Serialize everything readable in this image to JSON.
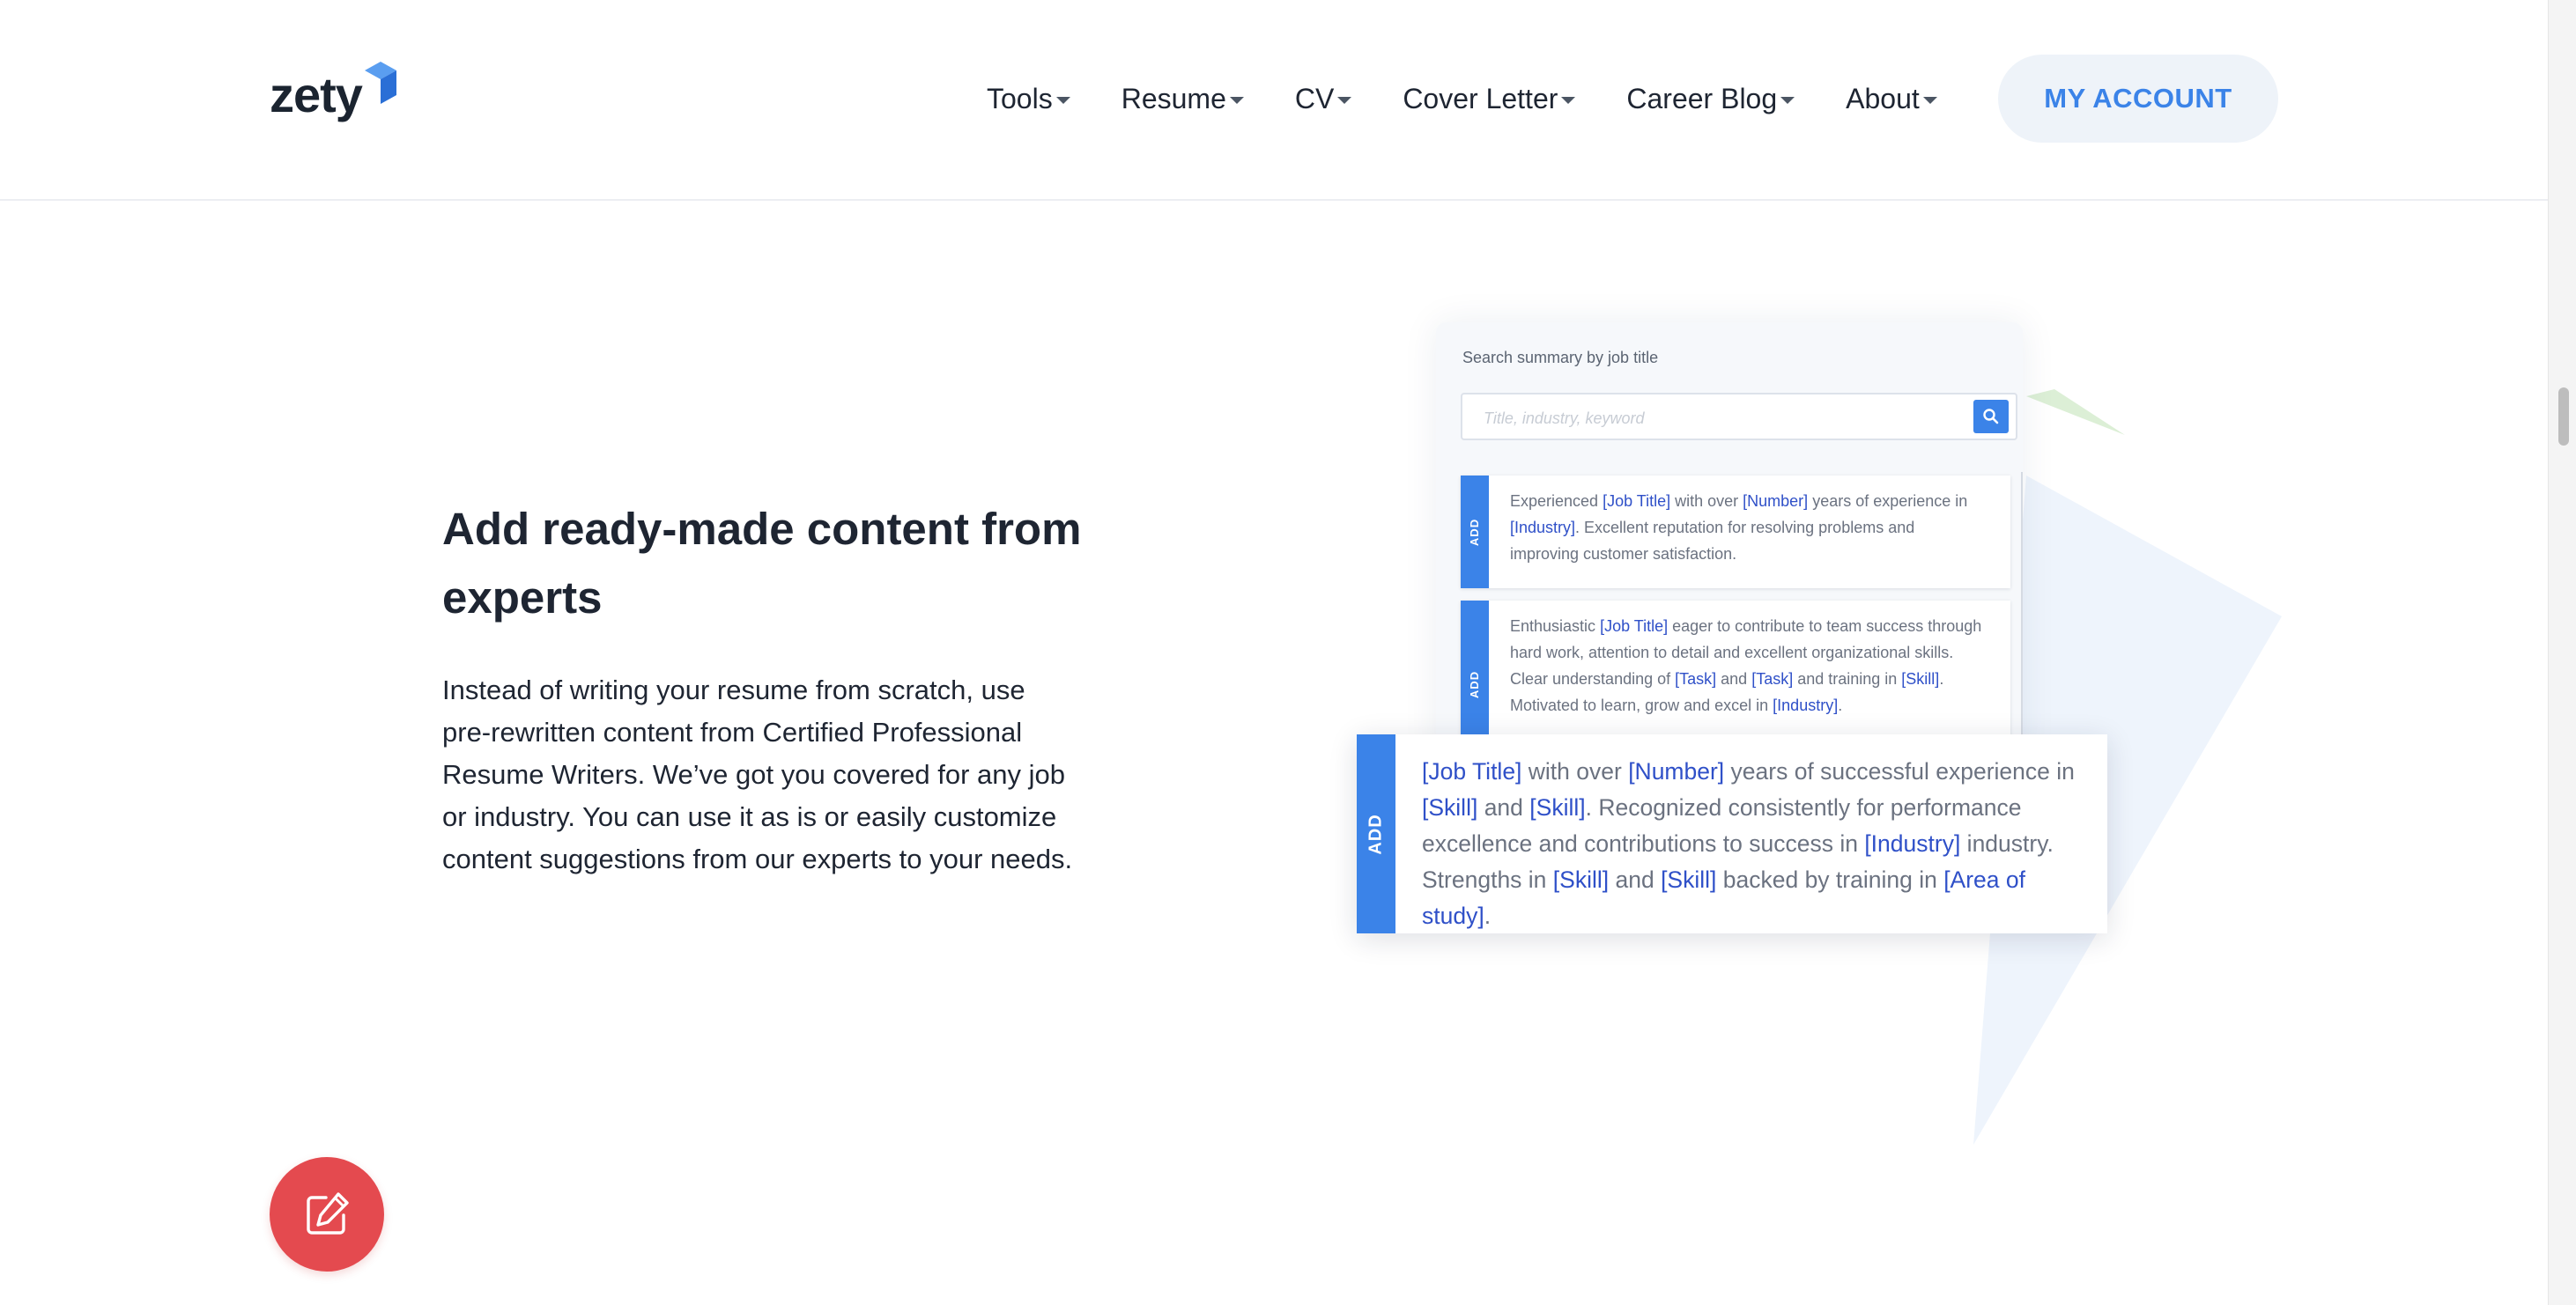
{
  "brand": {
    "logo_text": "zety",
    "logo_mark_color": "#3b83e8"
  },
  "nav": {
    "items": [
      {
        "label": "Tools"
      },
      {
        "label": "Resume"
      },
      {
        "label": "CV"
      },
      {
        "label": "Cover Letter"
      },
      {
        "label": "Career Blog"
      },
      {
        "label": "About"
      }
    ],
    "account_label": "MY ACCOUNT"
  },
  "section": {
    "heading": "Add ready-made content from experts",
    "body": "Instead of writing your resume from scratch, use pre-rewritten content from Certified Professional Resume Writers. We’ve got you covered for any job or industry. You can use it as is or easily customize content suggestions from our experts to your needs."
  },
  "illustration": {
    "panel_label": "Search summary by job title",
    "search_placeholder": "Title, industry, keyword",
    "add_label": "ADD",
    "cards": [
      {
        "segments": [
          {
            "t": "Experienced "
          },
          {
            "t": "[Job Title]",
            "ph": true
          },
          {
            "t": " with over "
          },
          {
            "t": "[Number]",
            "ph": true
          },
          {
            "t": " years of experience in "
          },
          {
            "t": "[Industry]",
            "ph": true
          },
          {
            "t": ". Excellent reputation for resolving problems and improving customer satisfaction."
          }
        ]
      },
      {
        "segments": [
          {
            "t": "Enthusiastic "
          },
          {
            "t": "[Job Title]",
            "ph": true
          },
          {
            "t": " eager to contribute to team success through hard work, attention to detail and excellent organizational skills. Clear understanding of "
          },
          {
            "t": "[Task]",
            "ph": true
          },
          {
            "t": " and "
          },
          {
            "t": "[Task]",
            "ph": true
          },
          {
            "t": " and training in "
          },
          {
            "t": "[Skill]",
            "ph": true
          },
          {
            "t": ". Motivated to learn, grow and excel in "
          },
          {
            "t": "[Industry]",
            "ph": true
          },
          {
            "t": "."
          }
        ]
      },
      {
        "segments": [
          {
            "t": "[Job Title]",
            "ph": true
          },
          {
            "t": " with over "
          },
          {
            "t": "[Number]",
            "ph": true
          },
          {
            "t": " years of successful experience in "
          },
          {
            "t": "[Skill]",
            "ph": true
          },
          {
            "t": " and "
          },
          {
            "t": "[Skill]",
            "ph": true
          },
          {
            "t": ". Recognized consistently for performance excellence and contributions to success in "
          },
          {
            "t": "[Industry]",
            "ph": true
          },
          {
            "t": " industry. Strengths in "
          },
          {
            "t": "[Skill]",
            "ph": true
          },
          {
            "t": " and "
          },
          {
            "t": "[Skill]",
            "ph": true
          },
          {
            "t": " backed by training in "
          },
          {
            "t": "[Area of study]",
            "ph": true
          },
          {
            "t": "."
          }
        ]
      }
    ],
    "colors": {
      "accent": "#3b83e8",
      "placeholder_text": "#2f50c8",
      "triangle_blue": "#eef4fc",
      "triangle_green": "#dcefd6"
    }
  },
  "fab": {
    "icon": "edit-icon",
    "color": "#e44a4f"
  }
}
